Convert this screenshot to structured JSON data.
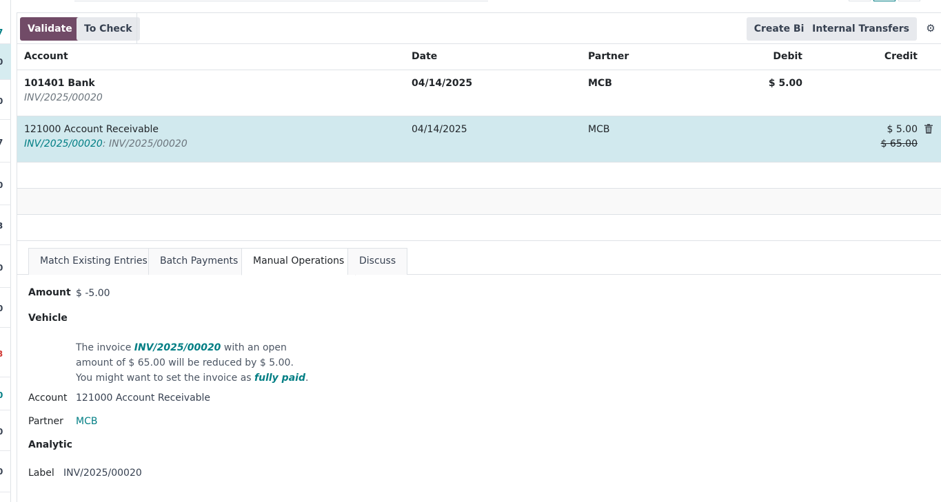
{
  "left_strip": [
    {
      "text": "7",
      "style": "teal"
    },
    {
      "text": "0",
      "style": "sel"
    },
    {
      "text": "0",
      "style": ""
    },
    {
      "text": "7",
      "style": ""
    },
    {
      "text": "0",
      "style": ""
    },
    {
      "text": "3",
      "style": ""
    },
    {
      "text": "0",
      "style": ""
    },
    {
      "text": "0",
      "style": ""
    },
    {
      "text": "3",
      "style": "red"
    },
    {
      "text": "0",
      "style": "teal"
    },
    {
      "text": "0",
      "style": ""
    },
    {
      "text": "0",
      "style": ""
    }
  ],
  "toolbar": {
    "validate_label": "Validate",
    "to_check_label": "To Check",
    "create_bill_label": "Create Bill",
    "internal_transfers_label": "Internal Transfers",
    "settings_icon": "gear-icon"
  },
  "table": {
    "headers": {
      "account": "Account",
      "date": "Date",
      "partner": "Partner",
      "debit": "Debit",
      "credit": "Credit"
    },
    "rows": [
      {
        "account": "101401 Bank",
        "label": "INV/2025/00020",
        "date": "04/14/2025",
        "partner": "MCB",
        "debit": "$ 5.00",
        "credit": ""
      },
      {
        "account": "121000 Account Receivable",
        "label_link": "INV/2025/00020",
        "label_sep": ": ",
        "label": "INV/2025/00020",
        "date": "04/14/2025",
        "partner": "MCB",
        "debit": "",
        "credit": "$ 5.00",
        "credit_original": "$ 65.00"
      }
    ]
  },
  "tabs": [
    {
      "label": "Match Existing Entries",
      "active": false
    },
    {
      "label": "Batch Payments",
      "active": false
    },
    {
      "label": "Manual Operations",
      "active": true
    },
    {
      "label": "Discuss",
      "active": false
    }
  ],
  "form": {
    "amount_label": "Amount",
    "amount_value": "$ -5.00",
    "vehicle_label": "Vehicle",
    "note": {
      "prefix": "The invoice ",
      "invoice": "INV/2025/00020",
      "middle": " with an open amount of $ 65.00 will be reduced by $ 5.00.",
      "line3_prefix": "You might want to set the invoice as ",
      "fully_paid": "fully paid",
      "line3_suffix": "."
    },
    "account_label": "Account",
    "account_value": "121000 Account Receivable",
    "partner_label": "Partner",
    "partner_value": "MCB",
    "analytic_label": "Analytic",
    "label_label": "Label",
    "label_value": "INV/2025/00020"
  },
  "colors": {
    "primary": "#714b67",
    "teal": "#017e84",
    "selected_row": "#d1e9ee"
  }
}
